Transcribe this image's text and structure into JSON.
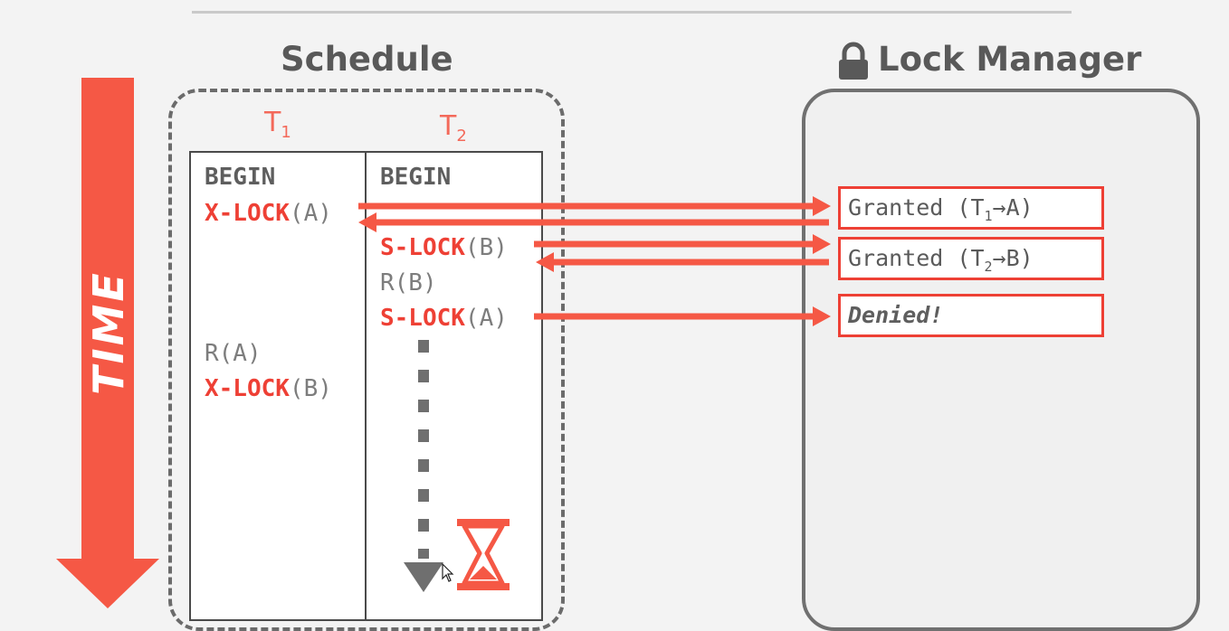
{
  "schedule": {
    "title": "Schedule",
    "t1": {
      "base": "T",
      "sub": "1"
    },
    "t2": {
      "base": "T",
      "sub": "2"
    }
  },
  "time_label": "TIME",
  "lock_manager": {
    "title": "Lock Manager"
  },
  "t1_ops": [
    {
      "kw": "",
      "rest": "BEGIN"
    },
    {
      "kw": "X-LOCK",
      "rest": "(A)"
    },
    {
      "kw": "",
      "rest": "R(A)"
    },
    {
      "kw": "X-LOCK",
      "rest": "(B)"
    }
  ],
  "t2_ops": [
    {
      "kw": "",
      "rest": "BEGIN"
    },
    {
      "kw": "S-LOCK",
      "rest": "(B)"
    },
    {
      "kw": "",
      "rest": "R(B)"
    },
    {
      "kw": "S-LOCK",
      "rest": "(A)"
    }
  ],
  "lm_entries": [
    {
      "pre": "Granted (T",
      "sub": "1",
      "post": "→A)"
    },
    {
      "pre": "Granted (T",
      "sub": "2",
      "post": "→B)"
    },
    {
      "text": "Denied!"
    }
  ],
  "icons": {
    "lock": "lock-icon",
    "wait": "hourglass-icon",
    "time": "time-arrow-icon"
  },
  "colors": {
    "accent": "#ee4035",
    "tx_label": "#f3695a",
    "frame": "#6b6b6b",
    "background": "#f3f3f3"
  }
}
